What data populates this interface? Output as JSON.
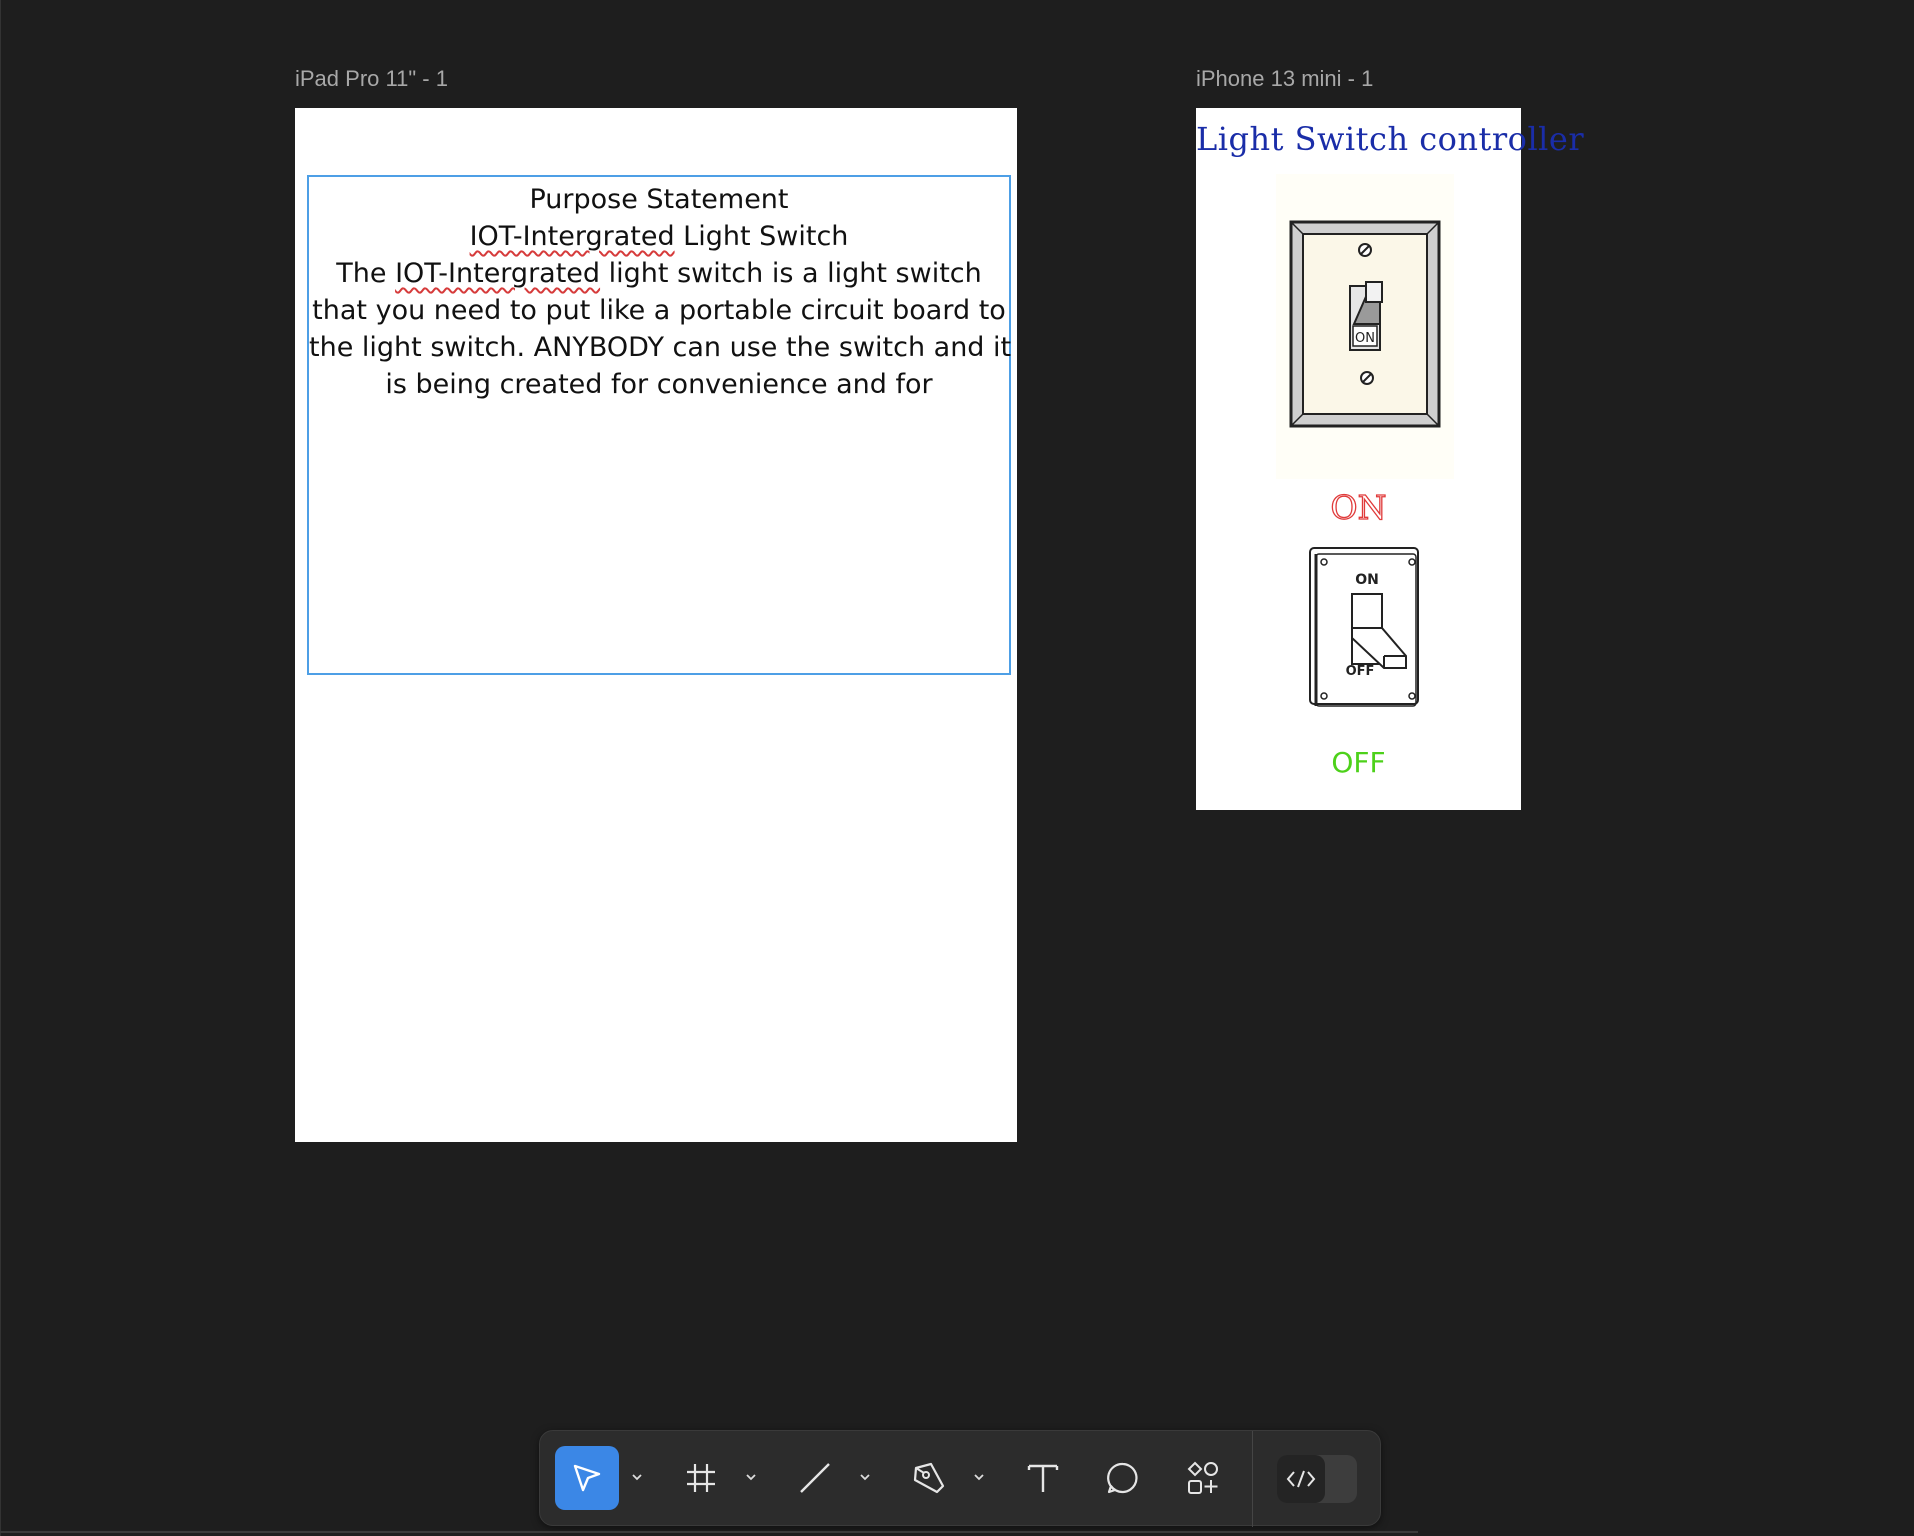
{
  "canvas": {
    "frames": [
      {
        "label": "iPad Pro 11\" - 1"
      },
      {
        "label": "iPhone 13 mini - 1"
      }
    ]
  },
  "ipad": {
    "text_lines": [
      "Purpose Statement",
      "IOT-Intergrated",
      " Light Switch",
      "The ",
      "IOT-Intergrated",
      " light switch is a light switch",
      "that you need to put like a portable circuit board to",
      "the light switch. ANYBODY can use the switch and it",
      "is being created for convenience and for"
    ]
  },
  "iphone": {
    "title": "Light Switch controller",
    "on_label": "ON",
    "off_label": "OFF",
    "switch_on_plate_text": "ON",
    "switch_off_top_text": "ON",
    "switch_off_bottom_text": "OFF"
  },
  "toolbar": {
    "tools": [
      {
        "name": "move-tool",
        "icon": "pointer-icon",
        "active": true
      },
      {
        "name": "frame-tool",
        "icon": "frame-grid-icon",
        "active": false
      },
      {
        "name": "line-tool",
        "icon": "line-icon",
        "active": false
      },
      {
        "name": "pen-tool",
        "icon": "pen-icon",
        "active": false
      },
      {
        "name": "text-tool",
        "icon": "text-icon",
        "active": false
      },
      {
        "name": "comment-tool",
        "icon": "comment-icon",
        "active": false
      },
      {
        "name": "actions-tool",
        "icon": "shapes-plus-icon",
        "active": false
      },
      {
        "name": "dev-mode-toggle",
        "icon": "code-icon",
        "active": false
      }
    ]
  },
  "colors": {
    "canvas_bg": "#1e1e1e",
    "selection_blue": "#4d9fe6",
    "title_blue": "#1a2da8",
    "on_red": "#e03a3a",
    "off_green": "#4dd11a",
    "tool_active": "#3b87e6"
  }
}
